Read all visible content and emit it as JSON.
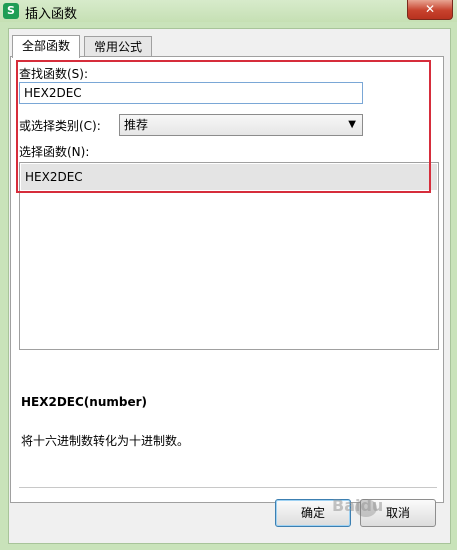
{
  "window": {
    "title": "插入函数",
    "app_icon": "S",
    "close_glyph": "✕"
  },
  "tabs": [
    {
      "label": "全部函数",
      "active": true
    },
    {
      "label": "常用公式",
      "active": false
    }
  ],
  "search": {
    "label": "查找函数(S):",
    "value": "HEX2DEC"
  },
  "category": {
    "label": "或选择类别(C):",
    "selected": "推荐"
  },
  "function_list": {
    "label": "选择函数(N):",
    "items": [
      "HEX2DEC"
    ]
  },
  "details": {
    "signature": "HEX2DEC(number)",
    "description": "将十六进制数转化为十进制数。"
  },
  "buttons": {
    "ok": "确定",
    "cancel": "取消"
  },
  "colors": {
    "highlight_box": "#d62d3b",
    "title_bar": "#c9e3ba"
  },
  "watermark": "Baidu"
}
